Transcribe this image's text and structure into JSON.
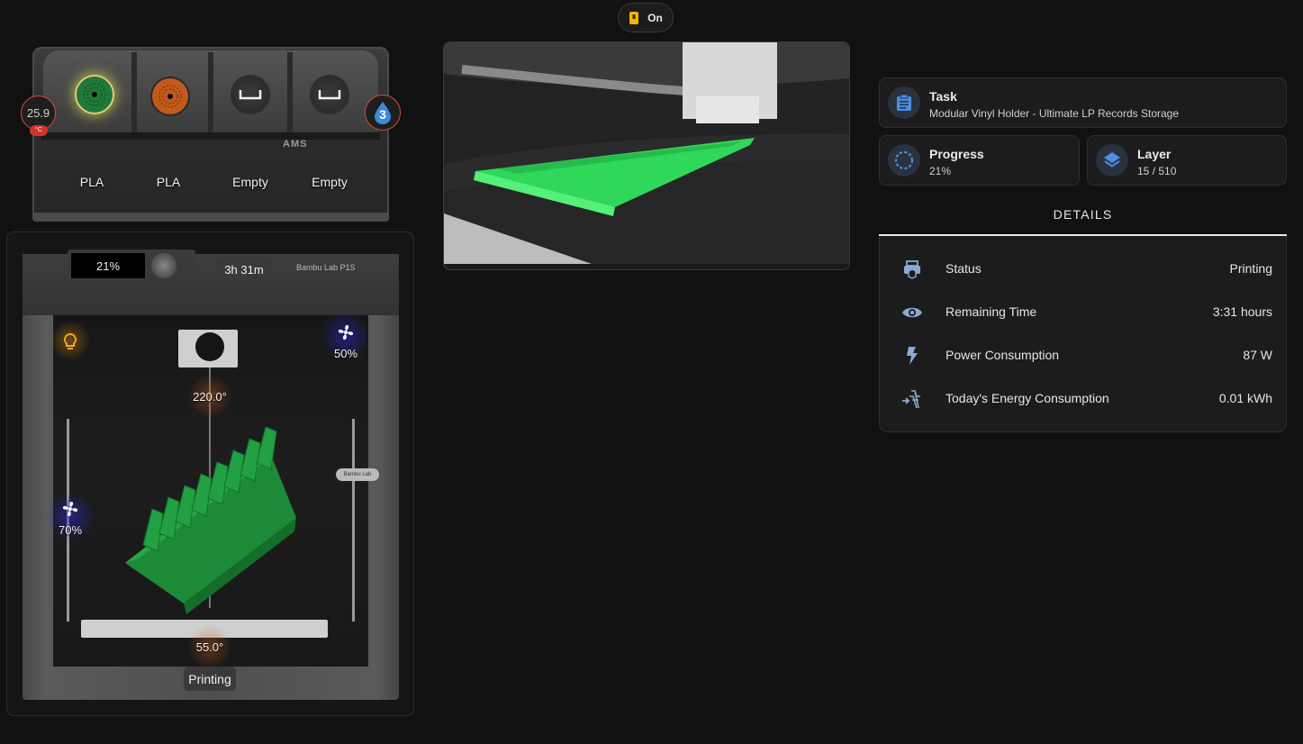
{
  "power": {
    "label": "On"
  },
  "ams": {
    "brand": "AMS",
    "temperature": "25.9",
    "temperature_unit": "°C",
    "humidity_level": "3",
    "slots": [
      {
        "label": "PLA",
        "color": "#1f7a3a",
        "state": "active"
      },
      {
        "label": "PLA",
        "color": "#c25a1c",
        "state": "loaded"
      },
      {
        "label": "Empty",
        "color": "#333333",
        "state": "empty"
      },
      {
        "label": "Empty",
        "color": "#333333",
        "state": "empty"
      }
    ]
  },
  "printer": {
    "screen_progress": "21%",
    "remaining_time": "3h 31m",
    "brand": "Bambu Lab P1S",
    "side_badge": "Bambu Lab",
    "nozzle_temp": "220.0°",
    "bed_temp": "55.0°",
    "aux_fan": "50%",
    "part_fan": "70%",
    "status": "Printing"
  },
  "cards": {
    "task": {
      "title": "Task",
      "value": "Modular Vinyl Holder - Ultimate LP Records Storage"
    },
    "progress": {
      "title": "Progress",
      "value": "21%",
      "fraction": 0.21
    },
    "layer": {
      "title": "Layer",
      "value": "15 / 510"
    }
  },
  "details": {
    "tab_label": "DETAILS",
    "rows": [
      {
        "icon": "printer-icon",
        "label": "Status",
        "value": "Printing"
      },
      {
        "icon": "eye-icon",
        "label": "Remaining Time",
        "value": "3:31 hours"
      },
      {
        "icon": "lightning-bolt-icon",
        "label": "Power Consumption",
        "value": "87 W"
      },
      {
        "icon": "transmission-tower-import-icon",
        "label": "Today's Energy Consumption",
        "value": "0.01 kWh"
      }
    ]
  },
  "colors": {
    "accent": "#4a8fe0",
    "filament_green": "#22b24a",
    "temp_badge": "#d84a3c"
  }
}
